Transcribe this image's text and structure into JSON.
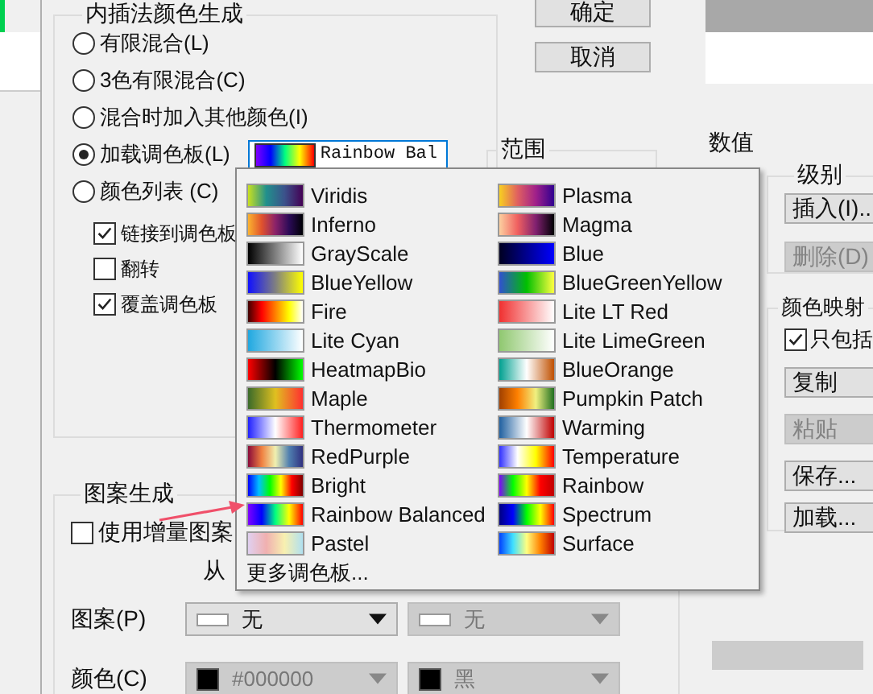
{
  "dialog": {
    "interpolation_group": {
      "title": "内插法颜色生成",
      "options": [
        {
          "label": "有限混合(L)",
          "selected": false
        },
        {
          "label": "3色有限混合(C)",
          "selected": false
        },
        {
          "label": "混合时加入其他颜色(I)",
          "selected": false
        },
        {
          "label": "加载调色板(L)",
          "selected": true
        },
        {
          "label": "颜色列表 (C)",
          "selected": false
        }
      ],
      "palette_field": {
        "value": "Rainbow Bal"
      },
      "checkboxes": [
        {
          "label": "链接到调色板",
          "checked": true
        },
        {
          "label": "翻转",
          "checked": false
        },
        {
          "label": "覆盖调色板",
          "checked": true
        }
      ]
    },
    "buttons": [
      "确定",
      "取消"
    ],
    "range_group": {
      "title": "范围"
    },
    "pattern_group": {
      "title": "图案生成",
      "checkbox": {
        "label": "使用增量图案",
        "checked": false
      },
      "from_label": "从",
      "rows": [
        {
          "label": "图案(P)",
          "dropdowns": [
            {
              "kind": "pattern",
              "value": "无",
              "disabled": false
            },
            {
              "kind": "pattern",
              "value": "无",
              "disabled": true
            }
          ]
        },
        {
          "label": "颜色(C)",
          "dropdowns": [
            {
              "kind": "color",
              "color": "#000000",
              "value": "#000000",
              "disabled": true
            },
            {
              "kind": "color",
              "color": "#000000",
              "value": "黑",
              "disabled": true
            }
          ]
        }
      ]
    }
  },
  "palette_menu": {
    "columns": [
      [
        {
          "name": "Viridis"
        },
        {
          "name": "Inferno"
        },
        {
          "name": "GrayScale"
        },
        {
          "name": "BlueYellow"
        },
        {
          "name": "Fire"
        },
        {
          "name": "Lite Cyan"
        },
        {
          "name": "HeatmapBio"
        },
        {
          "name": "Maple"
        },
        {
          "name": "Thermometer"
        },
        {
          "name": "RedPurple"
        },
        {
          "name": "Bright"
        },
        {
          "name": "Rainbow Balanced"
        },
        {
          "name": "Pastel"
        }
      ],
      [
        {
          "name": "Plasma"
        },
        {
          "name": "Magma"
        },
        {
          "name": "Blue"
        },
        {
          "name": "BlueGreenYellow"
        },
        {
          "name": "Lite LT Red"
        },
        {
          "name": "Lite LimeGreen"
        },
        {
          "name": "BlueOrange"
        },
        {
          "name": "Pumpkin Patch"
        },
        {
          "name": "Warming"
        },
        {
          "name": "Temperature"
        },
        {
          "name": "Rainbow"
        },
        {
          "name": "Spectrum"
        },
        {
          "name": "Surface"
        }
      ]
    ],
    "more": "更多调色板..."
  },
  "background_window": {
    "values_label": "数值",
    "levels_group": {
      "title": "级别",
      "buttons": [
        {
          "label": "插入(I)..",
          "disabled": false
        },
        {
          "label": "删除(D)",
          "disabled": true
        }
      ]
    },
    "colormap_group": {
      "title": "颜色映射",
      "checkbox": {
        "label": "只包括",
        "checked": true
      },
      "buttons": [
        {
          "label": "复制",
          "disabled": false
        },
        {
          "label": "粘贴",
          "disabled": true
        },
        {
          "label": "保存...",
          "disabled": false
        },
        {
          "label": "加载...",
          "disabled": false
        }
      ]
    }
  }
}
